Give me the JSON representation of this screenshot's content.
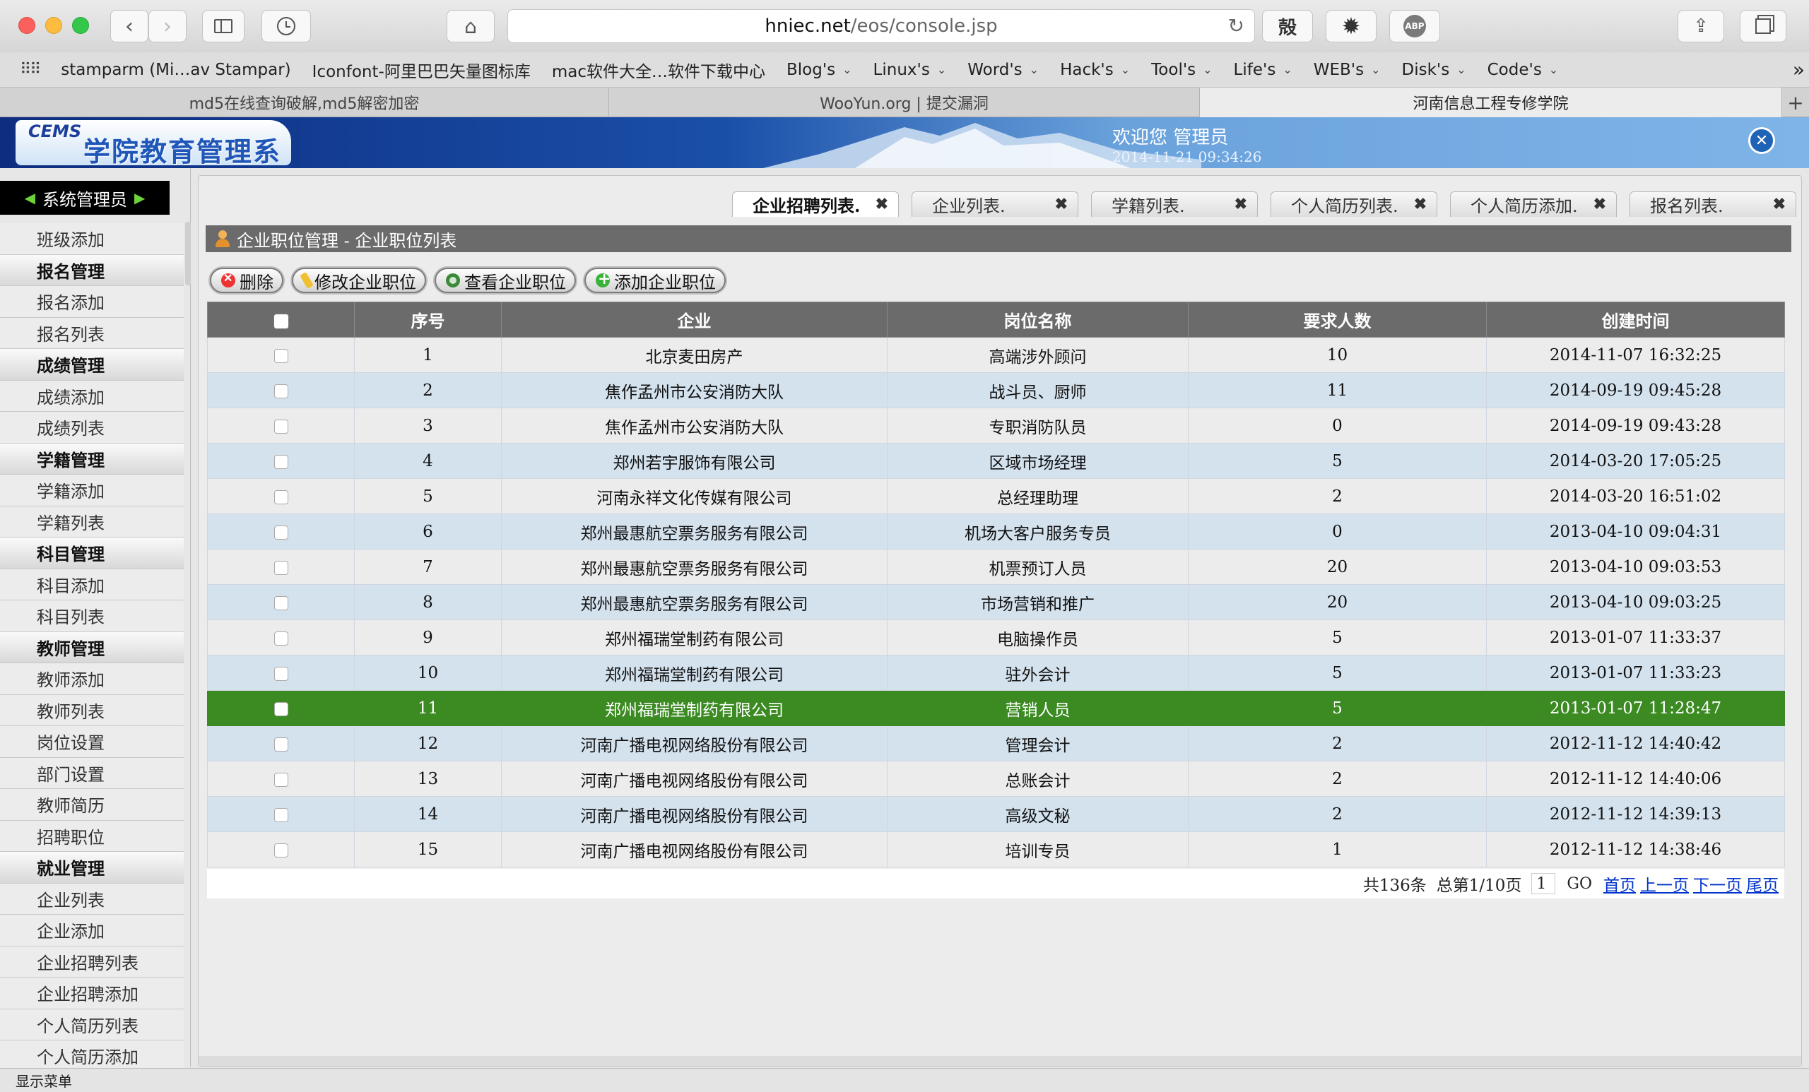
{
  "browser": {
    "url_host": "hniec.net",
    "url_path": "/eos/console.jsp",
    "toolbar_glyph": "殻",
    "abp": "ABP",
    "bookmarks": [
      {
        "label": "stamparm (Mi…av Stampar)",
        "menu": false
      },
      {
        "label": "Iconfont-阿里巴巴矢量图标库",
        "menu": false
      },
      {
        "label": "mac软件大全…软件下载中心",
        "menu": false
      },
      {
        "label": "Blog's",
        "menu": true
      },
      {
        "label": "Linux's",
        "menu": true
      },
      {
        "label": "Word's",
        "menu": true
      },
      {
        "label": "Hack's",
        "menu": true
      },
      {
        "label": "Tool's",
        "menu": true
      },
      {
        "label": "Life's",
        "menu": true
      },
      {
        "label": "WEB's",
        "menu": true
      },
      {
        "label": "Disk's",
        "menu": true
      },
      {
        "label": "Code's",
        "menu": true
      }
    ],
    "more": "»",
    "tabs": [
      {
        "label": "md5在线查询破解,md5解密加密",
        "active": false
      },
      {
        "label": "WooYun.org | 提交漏洞",
        "active": false
      },
      {
        "label": "河南信息工程专修学院",
        "active": true
      }
    ],
    "new_tab": "+"
  },
  "header": {
    "logo_small": "CEMS",
    "logo_name": "学院教育管理系统",
    "welcome": "欢迎您 管理员",
    "datetime": "2014-11-21 09:34:26",
    "close": "✕"
  },
  "sidebar": {
    "title": "系统管理员",
    "items": [
      {
        "label": "班级添加",
        "type": "item"
      },
      {
        "label": "报名管理",
        "type": "group"
      },
      {
        "label": "报名添加",
        "type": "item"
      },
      {
        "label": "报名列表",
        "type": "item"
      },
      {
        "label": "成绩管理",
        "type": "group"
      },
      {
        "label": "成绩添加",
        "type": "item"
      },
      {
        "label": "成绩列表",
        "type": "item"
      },
      {
        "label": "学籍管理",
        "type": "group"
      },
      {
        "label": "学籍添加",
        "type": "item"
      },
      {
        "label": "学籍列表",
        "type": "item"
      },
      {
        "label": "科目管理",
        "type": "group"
      },
      {
        "label": "科目添加",
        "type": "item"
      },
      {
        "label": "科目列表",
        "type": "item"
      },
      {
        "label": "教师管理",
        "type": "group"
      },
      {
        "label": "教师添加",
        "type": "item"
      },
      {
        "label": "教师列表",
        "type": "item"
      },
      {
        "label": "岗位设置",
        "type": "item"
      },
      {
        "label": "部门设置",
        "type": "item"
      },
      {
        "label": "教师简历",
        "type": "item"
      },
      {
        "label": "招聘职位",
        "type": "item"
      },
      {
        "label": "就业管理",
        "type": "group"
      },
      {
        "label": "企业列表",
        "type": "item"
      },
      {
        "label": "企业添加",
        "type": "item"
      },
      {
        "label": "企业招聘列表",
        "type": "item"
      },
      {
        "label": "企业招聘添加",
        "type": "item"
      },
      {
        "label": "个人简历列表",
        "type": "item"
      },
      {
        "label": "个人简历添加",
        "type": "item"
      }
    ]
  },
  "content": {
    "tabs": [
      {
        "label": "企业招聘列表.",
        "active": true
      },
      {
        "label": "企业列表.",
        "active": false
      },
      {
        "label": "学籍列表.",
        "active": false
      },
      {
        "label": "个人简历列表.",
        "active": false
      },
      {
        "label": "个人简历添加.",
        "active": false
      },
      {
        "label": "报名列表.",
        "active": false
      }
    ],
    "tab_close": "✖",
    "panel_title": "企业职位管理 - 企业职位列表",
    "toolbar": {
      "delete": "删除",
      "edit": "修改企业职位",
      "view": "查看企业职位",
      "add": "添加企业职位"
    },
    "table": {
      "headers": [
        "序号",
        "企业",
        "岗位名称",
        "要求人数",
        "创建时间"
      ],
      "selected_index": 10,
      "rows": [
        {
          "no": "1",
          "company": "北京麦田房产",
          "position": "高端涉外顾问",
          "count": "10",
          "created": "2014-11-07 16:32:25"
        },
        {
          "no": "2",
          "company": "焦作孟州市公安消防大队",
          "position": "战斗员、厨师",
          "count": "11",
          "created": "2014-09-19 09:45:28"
        },
        {
          "no": "3",
          "company": "焦作孟州市公安消防大队",
          "position": "专职消防队员",
          "count": "0",
          "created": "2014-09-19 09:43:28"
        },
        {
          "no": "4",
          "company": "郑州若宇服饰有限公司",
          "position": "区域市场经理",
          "count": "5",
          "created": "2014-03-20 17:05:25"
        },
        {
          "no": "5",
          "company": "河南永祥文化传媒有限公司",
          "position": "总经理助理",
          "count": "2",
          "created": "2014-03-20 16:51:02"
        },
        {
          "no": "6",
          "company": "郑州最惠航空票务服务有限公司",
          "position": "机场大客户服务专员",
          "count": "0",
          "created": "2013-04-10 09:04:31"
        },
        {
          "no": "7",
          "company": "郑州最惠航空票务服务有限公司",
          "position": "机票预订人员",
          "count": "20",
          "created": "2013-04-10 09:03:53"
        },
        {
          "no": "8",
          "company": "郑州最惠航空票务服务有限公司",
          "position": "市场营销和推广",
          "count": "20",
          "created": "2013-04-10 09:03:25"
        },
        {
          "no": "9",
          "company": "郑州福瑞堂制药有限公司",
          "position": "电脑操作员",
          "count": "5",
          "created": "2013-01-07 11:33:37"
        },
        {
          "no": "10",
          "company": "郑州福瑞堂制药有限公司",
          "position": "驻外会计",
          "count": "5",
          "created": "2013-01-07 11:33:23"
        },
        {
          "no": "11",
          "company": "郑州福瑞堂制药有限公司",
          "position": "营销人员",
          "count": "5",
          "created": "2013-01-07 11:28:47"
        },
        {
          "no": "12",
          "company": "河南广播电视网络股份有限公司",
          "position": "管理会计",
          "count": "2",
          "created": "2012-11-12 14:40:42"
        },
        {
          "no": "13",
          "company": "河南广播电视网络股份有限公司",
          "position": "总账会计",
          "count": "2",
          "created": "2012-11-12 14:40:06"
        },
        {
          "no": "14",
          "company": "河南广播电视网络股份有限公司",
          "position": "高级文秘",
          "count": "2",
          "created": "2012-11-12 14:39:13"
        },
        {
          "no": "15",
          "company": "河南广播电视网络股份有限公司",
          "position": "培训专员",
          "count": "1",
          "created": "2012-11-12 14:38:46"
        }
      ]
    },
    "pager": {
      "total": "共136条",
      "page_info": "总第1/10页",
      "page_value": "1",
      "go": "GO",
      "first": "首页",
      "prev": "上一页",
      "next": "下一页",
      "last": "尾页"
    }
  },
  "statusbar": {
    "label": "显示菜单"
  },
  "colors": {
    "selected_row": "#3b8a22",
    "even_row": "#d4e2ee",
    "header_bg": "#6b6b6b"
  }
}
